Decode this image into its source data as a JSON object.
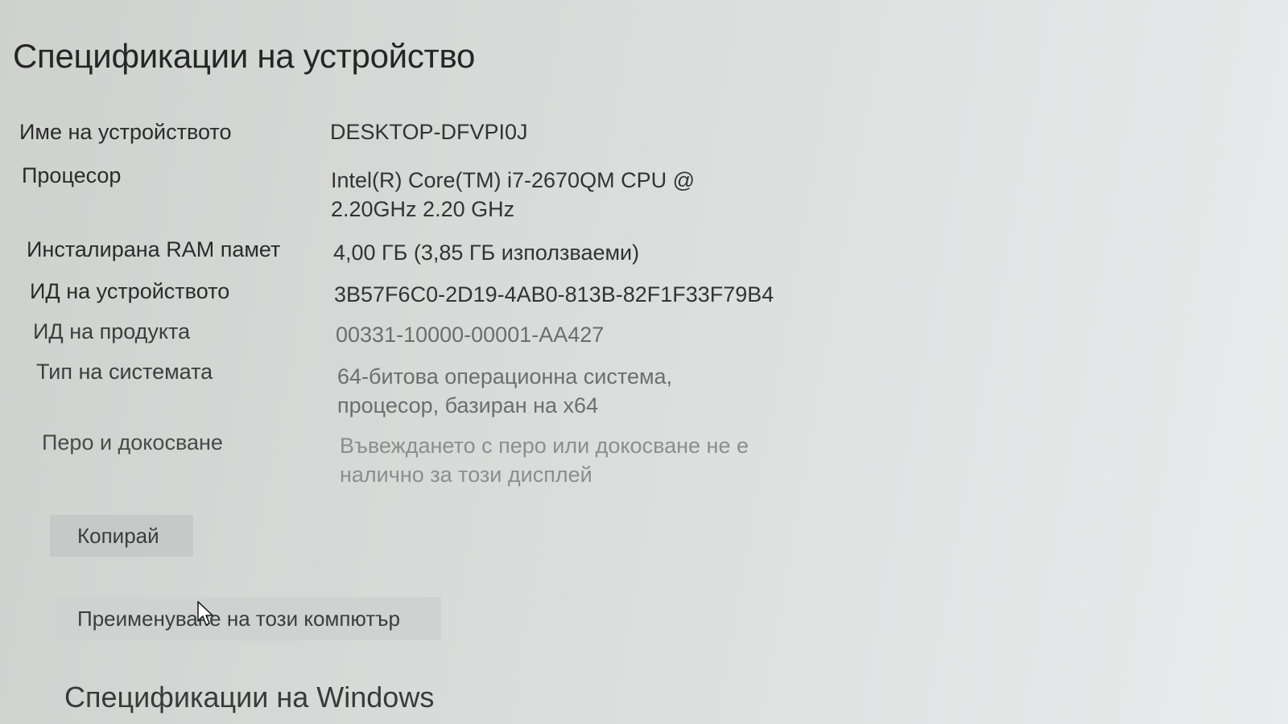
{
  "page": {
    "title": "Спецификации на устройство"
  },
  "specs": [
    {
      "label": "Име на устройството",
      "value": "DESKTOP-DFVPI0J"
    },
    {
      "label": "Процесор",
      "value": "Intel(R) Core(TM) i7-2670QM CPU @ 2.20GHz   2.20 GHz"
    },
    {
      "label": "Инсталирана RAM памет",
      "value": "4,00 ГБ (3,85 ГБ използваеми)"
    },
    {
      "label": "ИД на устройството",
      "value": "3B57F6C0-2D19-4AB0-813B-82F1F33F79B4"
    },
    {
      "label": "ИД на продукта",
      "value": "00331-10000-00001-AA427"
    },
    {
      "label": "Тип на системата",
      "value": "64-битова операционна система, процесор, базиран на x64"
    },
    {
      "label": "Перо и докосване",
      "value": "Въвеждането с перо или докосване не е налично за този дисплей"
    }
  ],
  "buttons": {
    "copy_label": "Копирай",
    "rename_label": "Преименуване на този компютър"
  },
  "windows_section": {
    "title": "Спецификации на Windows"
  },
  "icons": {
    "cursor": "mouse-pointer-icon"
  }
}
